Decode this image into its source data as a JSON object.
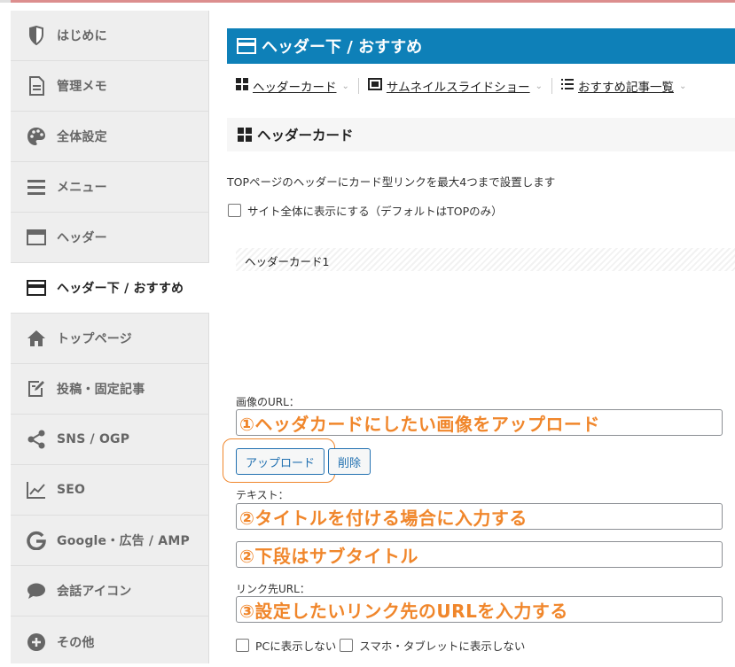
{
  "colors": {
    "accent_blue": "#0e80b8",
    "annotation_orange": "#f0862b",
    "sidebar_bg": "#eeeeee",
    "button_blue": "#2271b1"
  },
  "sidebar": {
    "items": [
      {
        "label": "はじめに",
        "icon": "shield-icon"
      },
      {
        "label": "管理メモ",
        "icon": "memo-icon"
      },
      {
        "label": "全体設定",
        "icon": "palette-icon"
      },
      {
        "label": "メニュー",
        "icon": "menu-icon"
      },
      {
        "label": "ヘッダー",
        "icon": "header-icon"
      },
      {
        "label": "ヘッダー下 / おすすめ",
        "icon": "under-header-icon",
        "active": true
      },
      {
        "label": "トップページ",
        "icon": "home-icon"
      },
      {
        "label": "投稿・固定記事",
        "icon": "edit-icon"
      },
      {
        "label": "SNS / OGP",
        "icon": "share-icon"
      },
      {
        "label": "SEO",
        "icon": "chart-icon"
      },
      {
        "label": "Google・広告 / AMP",
        "icon": "google-icon"
      },
      {
        "label": "会話アイコン",
        "icon": "chat-icon"
      },
      {
        "label": "その他",
        "icon": "plus-icon"
      }
    ]
  },
  "main": {
    "title": "ヘッダー下 / おすすめ",
    "tabs": [
      {
        "label": "ヘッダーカード",
        "icon": "grid-icon"
      },
      {
        "label": "サムネイルスライドショー",
        "icon": "image-icon"
      },
      {
        "label": "おすすめ記事一覧",
        "icon": "list-icon"
      }
    ],
    "section_title": "ヘッダーカード",
    "description": "TOPページのヘッダーにカード型リンクを最大4つまで設置します",
    "show_all_label": "サイト全体に表示にする（デフォルトはTOPのみ）",
    "card_title": "ヘッダーカード1",
    "image_url_label": "画像のURL：",
    "image_url_value": "①ヘッダカードにしたい画像をアップロード",
    "upload_button": "アップロード",
    "delete_button": "削除",
    "text_label": "テキスト：",
    "text_value_1": "②タイトルを付ける場合に入力する",
    "text_value_2": "②下段はサブタイトル",
    "link_label": "リンク先URL：",
    "link_value": "③設定したいリンク先のURLを入力する",
    "hide_pc_label": "PCに表示しない",
    "hide_sp_label": "スマホ・タブレットに表示しない"
  }
}
